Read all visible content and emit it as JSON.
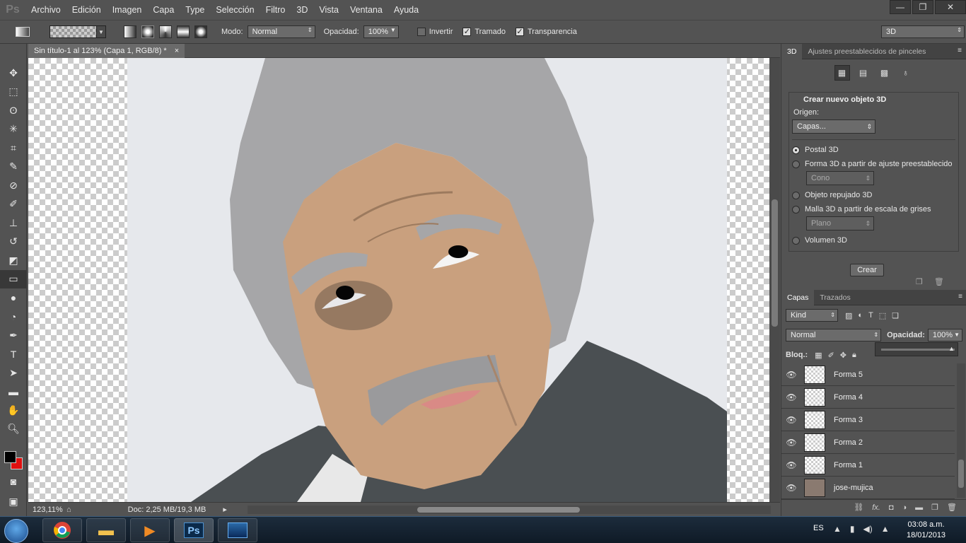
{
  "app": {
    "logo": "Ps",
    "menu": [
      "Archivo",
      "Edición",
      "Imagen",
      "Capa",
      "Type",
      "Selección",
      "Filtro",
      "3D",
      "Vista",
      "Ventana",
      "Ayuda"
    ],
    "window_controls": {
      "minimize": "—",
      "restore": "❐",
      "close": "✕"
    }
  },
  "options": {
    "mode_label": "Modo:",
    "mode_value": "Normal",
    "opacity_label": "Opacidad:",
    "opacity_value": "100%",
    "invert_label": "Invertir",
    "dither_label": "Tramado",
    "transparency_label": "Transparencia",
    "workspace_value": "3D",
    "invert_checked": false,
    "dither_checked": true,
    "transparency_checked": true
  },
  "tools": [
    "move",
    "marquee",
    "lasso",
    "magic-wand",
    "crop",
    "eyedropper",
    "healing",
    "brush",
    "stamp",
    "history-brush",
    "eraser",
    "gradient",
    "blur",
    "dodge",
    "pen",
    "type",
    "path-select",
    "shape",
    "hand",
    "zoom"
  ],
  "colors": {
    "foreground": "#000000",
    "background": "#e01010"
  },
  "document": {
    "tab_title": "Sin título-1 al 123% (Capa 1, RGB/8) *",
    "tab_close": "×",
    "zoom": "123,11%",
    "doc_info": "Doc: 2,25 MB/19,3 MB"
  },
  "panel3d": {
    "tab_active": "3D",
    "tab_other": "Ajustes preestablecidos de pinceles",
    "title": "Crear nuevo objeto 3D",
    "origin_label": "Origen:",
    "origin_value": "Capas...",
    "options": [
      {
        "label": "Postal 3D",
        "selected": true
      },
      {
        "label": "Forma 3D a partir de ajuste preestablecido",
        "selected": false
      },
      {
        "label": "Objeto repujado 3D",
        "selected": false
      },
      {
        "label": "Malla 3D a partir de escala de grises",
        "selected": false
      },
      {
        "label": "Volumen 3D",
        "selected": false
      }
    ],
    "preset_value": "Cono",
    "mesh_value": "Plano",
    "create_button": "Crear"
  },
  "layers": {
    "tab_active": "Capas",
    "tab_other": "Trazados",
    "kind_value": "Kind",
    "blend_value": "Normal",
    "opacity_label": "Opacidad:",
    "opacity_value": "100%",
    "lock_label": "Bloq.:",
    "items": [
      {
        "name": "Forma 5"
      },
      {
        "name": "Forma 4"
      },
      {
        "name": "Forma 3"
      },
      {
        "name": "Forma 2"
      },
      {
        "name": "Forma 1"
      },
      {
        "name": "jose-mujica"
      }
    ]
  },
  "taskbar": {
    "language": "ES",
    "time": "03:08 a.m.",
    "date": "18/01/2013",
    "apps": [
      "chrome",
      "explorer",
      "media-player",
      "photoshop",
      "game"
    ],
    "ps_label": "Ps"
  }
}
